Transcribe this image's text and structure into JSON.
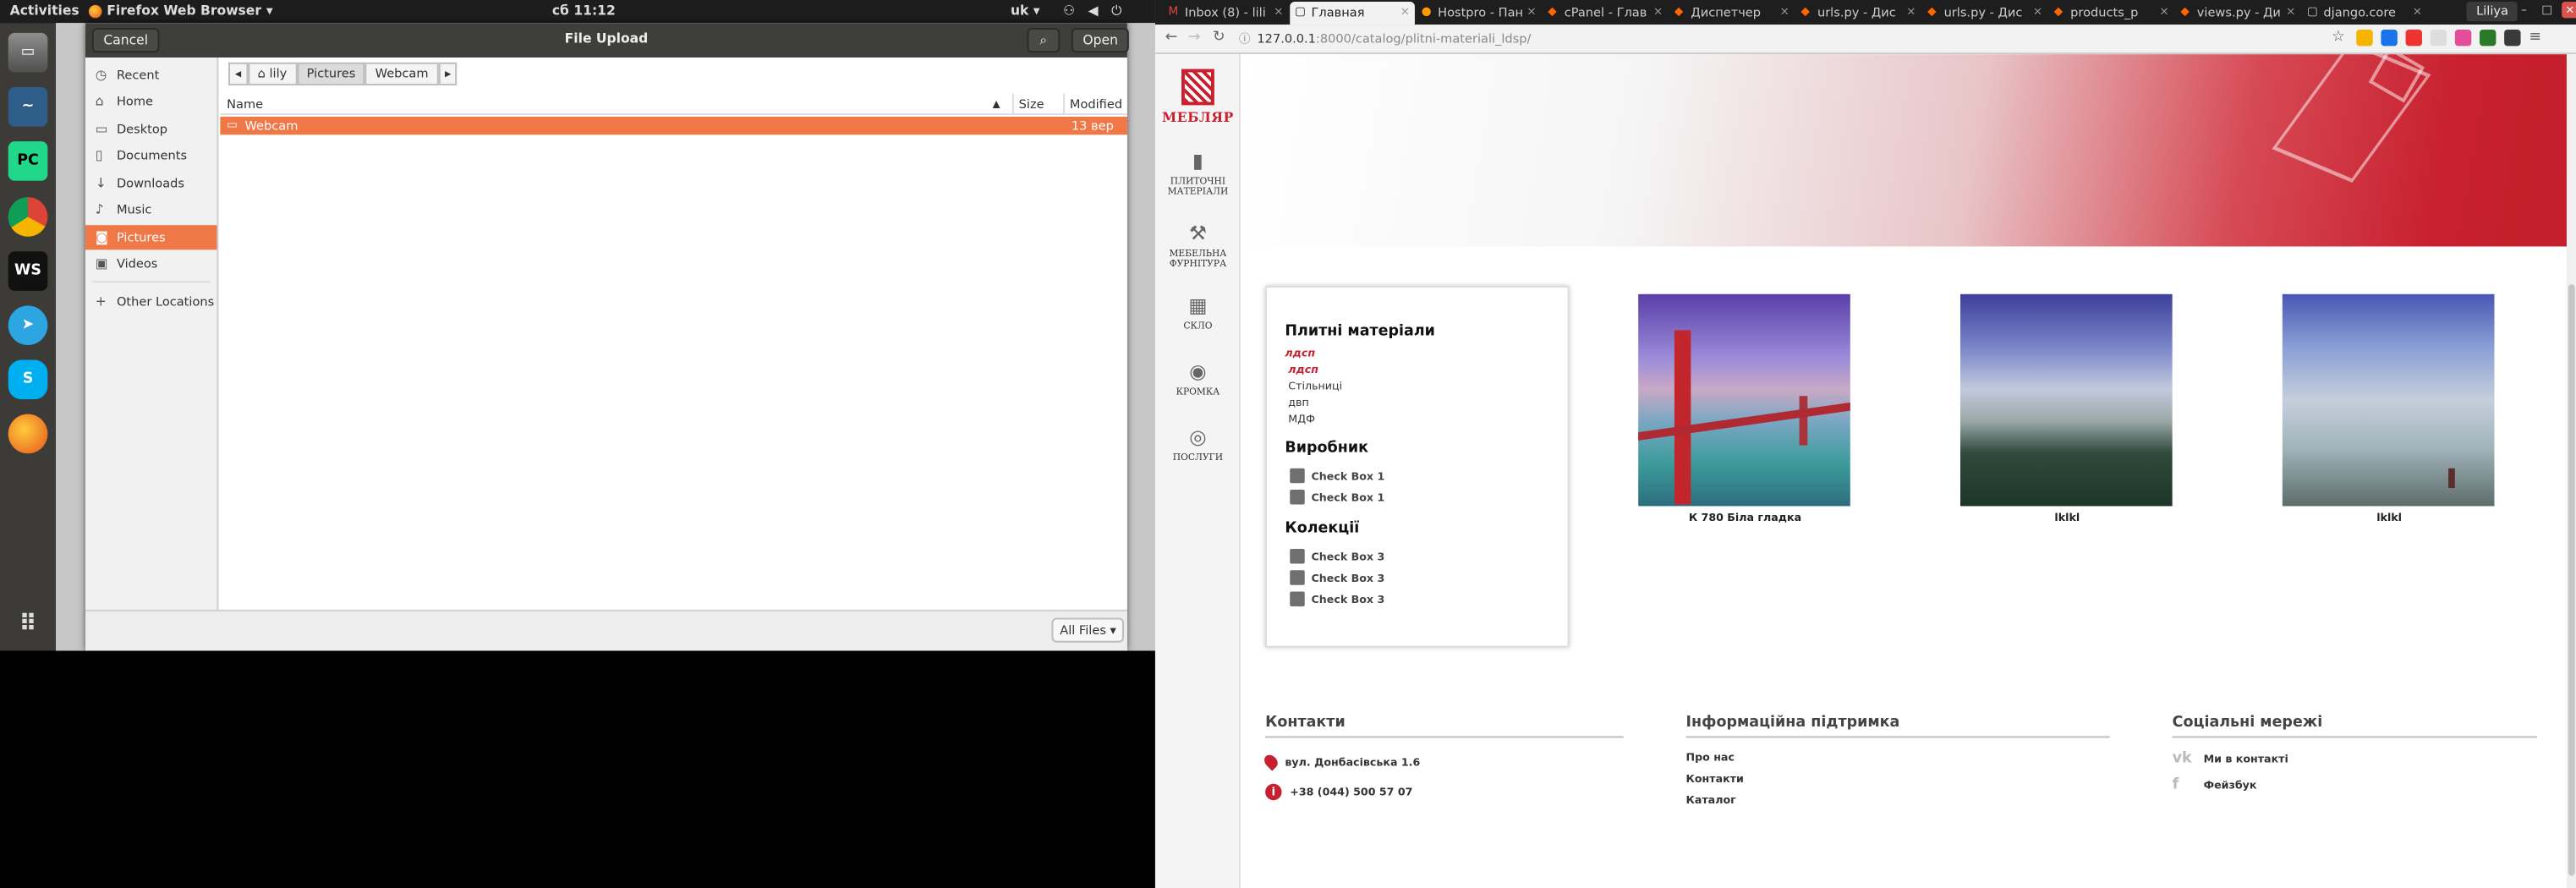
{
  "ubuntu_topbar": {
    "activities": "Activities",
    "app_menu": "Firefox Web Browser",
    "clock": "сб 11:12",
    "keyboard": "uk"
  },
  "dock": {
    "apps": [
      "files",
      "wireshark",
      "pycharm",
      "chrome",
      "webstorm",
      "telegram",
      "skype",
      "firefox",
      "show-apps"
    ],
    "pycharm_label": "PC",
    "webstorm_label": "WS"
  },
  "file_dialog": {
    "cancel_label": "Cancel",
    "title": "File Upload",
    "open_label": "Open",
    "places": [
      {
        "label": "Recent",
        "icon": "clock-icon"
      },
      {
        "label": "Home",
        "icon": "home-icon"
      },
      {
        "label": "Desktop",
        "icon": "folder-icon"
      },
      {
        "label": "Documents",
        "icon": "document-icon"
      },
      {
        "label": "Downloads",
        "icon": "download-icon"
      },
      {
        "label": "Music",
        "icon": "music-icon"
      },
      {
        "label": "Pictures",
        "icon": "camera-icon",
        "selected": true
      },
      {
        "label": "Videos",
        "icon": "video-icon"
      },
      {
        "label": "Other Locations",
        "icon": "plus-icon"
      }
    ],
    "path": [
      "lily",
      "Pictures",
      "Webcam"
    ],
    "columns": {
      "name": "Name",
      "size": "Size",
      "modified": "Modified"
    },
    "files": [
      {
        "name": "Webcam",
        "size": "",
        "modified": "13 вер",
        "selected": true
      }
    ],
    "filter_label": "All Files"
  },
  "browser": {
    "tabs": [
      {
        "title": "Inbox (8) - lili",
        "icon": "gmail-icon"
      },
      {
        "title": "Главная",
        "icon": "page-icon",
        "active": true
      },
      {
        "title": "Hostpro - Пан",
        "icon": "hostpro-icon"
      },
      {
        "title": "cPanel - Глав",
        "icon": "cpanel-icon"
      },
      {
        "title": "Диспетчер",
        "icon": "cpanel-icon"
      },
      {
        "title": "urls.py - Дис",
        "icon": "cpanel-icon"
      },
      {
        "title": "urls.py - Дис",
        "icon": "cpanel-icon"
      },
      {
        "title": "products_p",
        "icon": "cpanel-icon"
      },
      {
        "title": "views.py - Ди",
        "icon": "cpanel-icon"
      },
      {
        "title": "django.core",
        "icon": "page-icon"
      }
    ],
    "user": "Liliya",
    "url_host": "127.0.0.1",
    "url_rest": ":8000/catalog/plitni-materiali_ldsp/"
  },
  "site": {
    "logo_text": "МЕБЛЯР",
    "sidebar": [
      {
        "label": "ПЛИТОЧНІ МАТЕРІАЛИ",
        "icon": "panel-icon"
      },
      {
        "label": "МЕБЕЛЬНА ФУРНІТУРА",
        "icon": "hammer-icon"
      },
      {
        "label": "СКЛО",
        "icon": "glass-icon"
      },
      {
        "label": "КРОМКА",
        "icon": "edge-icon"
      },
      {
        "label": "ПОСЛУГИ",
        "icon": "service-icon"
      }
    ],
    "filters": {
      "materials_title": "Плитні матеріали",
      "materials": [
        {
          "label": "лдсп",
          "active": true
        },
        {
          "label": "лдсп",
          "active": true
        },
        {
          "label": "Стільниці"
        },
        {
          "label": "двп"
        },
        {
          "label": "МДФ"
        }
      ],
      "manufacturer_title": "Виробник",
      "manufacturers": [
        "Check Box 1",
        "Check Box 1"
      ],
      "collections_title": "Колекції",
      "collections": [
        "Check Box 3",
        "Check Box 3",
        "Check Box 3"
      ]
    },
    "products": [
      {
        "caption": "К 780 Біла гладка"
      },
      {
        "caption": "lklkl"
      },
      {
        "caption": "lklkl"
      }
    ],
    "footer": {
      "contacts_title": "Контакти",
      "address": "вул. Донбасівська 1.6",
      "phone": "+38 (044) 500 57 07",
      "support_title": "Інформаційна підтримка",
      "support_links": [
        "Про нас",
        "Контакти",
        "Каталог"
      ],
      "social_title": "Соціальні мережі",
      "vk": "Ми в контакті",
      "fb": "Фейзбук"
    }
  }
}
